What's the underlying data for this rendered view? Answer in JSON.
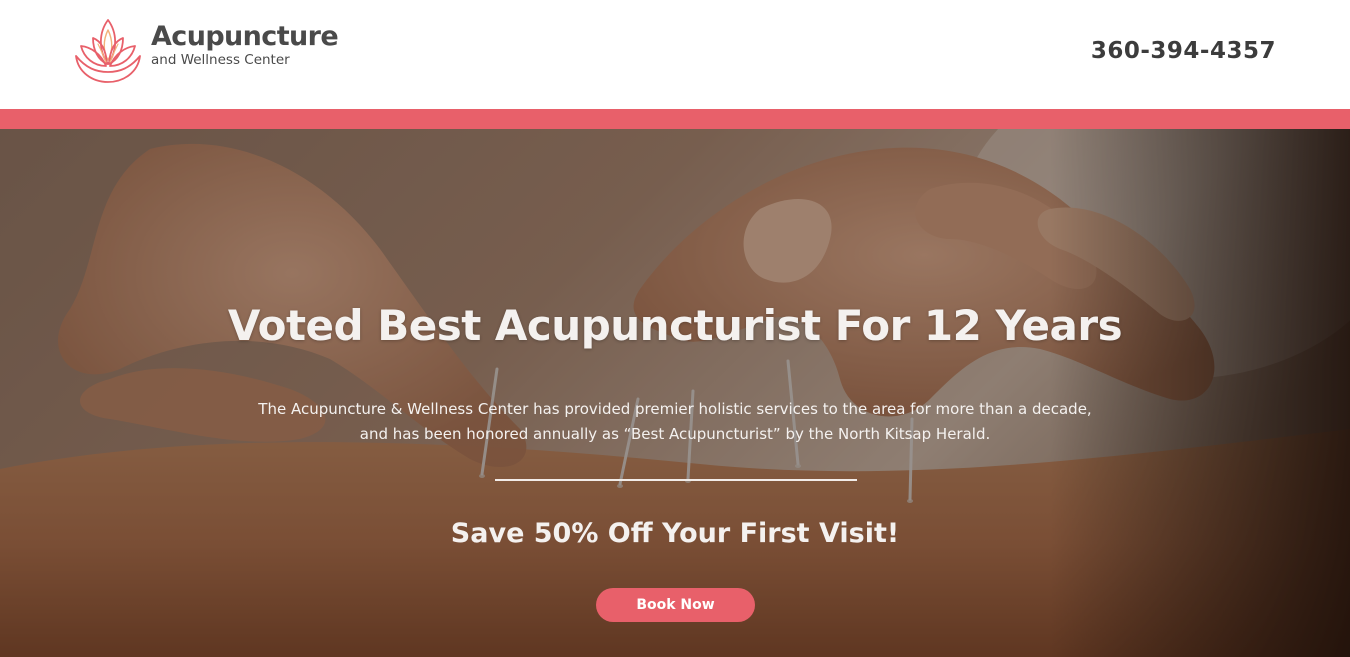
{
  "brand": {
    "name": "Acupuncture",
    "tagline": "and Wellness Center",
    "logo_icon": "lotus-icon",
    "accent_color": "#e8606a",
    "text_color": "#4a4a4a"
  },
  "header": {
    "phone": "360-394-4357"
  },
  "hero": {
    "background_image": "acupuncture-needles-photo",
    "heading": "Voted Best Acupuncturist For 12 Years",
    "body": "The Acupuncture & Wellness Center has provided premier holistic services to the area for more than a decade, and has been honored annually as “Best Acupuncturist” by the North Kitsap Herald.",
    "offer": "Save 50% Off Your First Visit!",
    "cta_label": "Book Now"
  }
}
